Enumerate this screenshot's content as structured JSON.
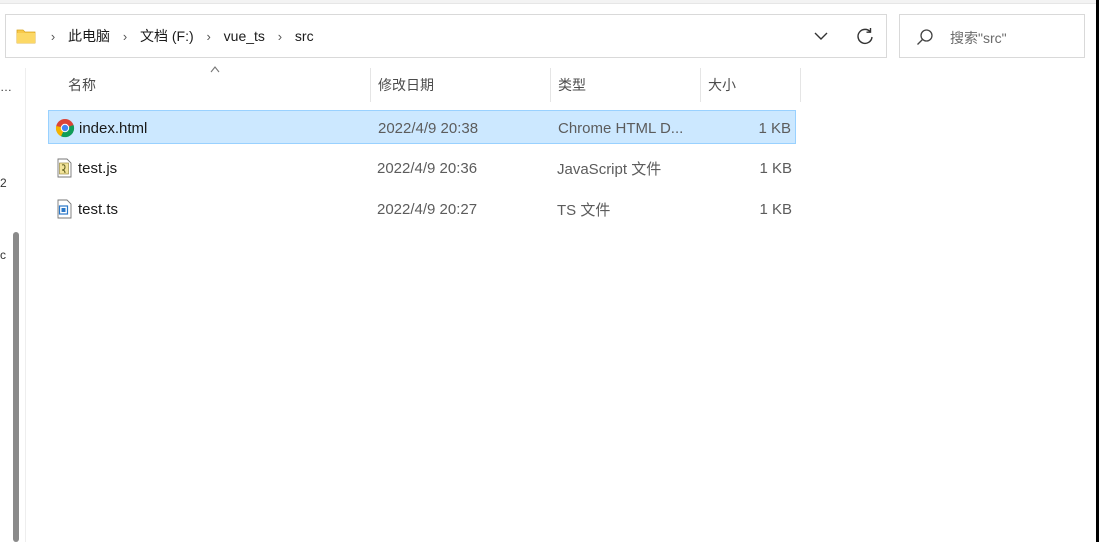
{
  "address_bar": {
    "crumbs": [
      "此电脑",
      "文档 (F:)",
      "vue_ts",
      "src"
    ],
    "folder_icon": "folder-icon",
    "dropdown_icon": "chevron-down-icon",
    "refresh_icon": "refresh-icon"
  },
  "search": {
    "placeholder": "搜索\"src\"",
    "icon": "search-icon"
  },
  "left_pane": {
    "fragments": [
      "…",
      "2",
      "c"
    ]
  },
  "columns": {
    "name": "名称",
    "date": "修改日期",
    "type": "类型",
    "size": "大小",
    "sort_icon": "sort-up-icon"
  },
  "files": [
    {
      "name": "index.html",
      "date": "2022/4/9 20:38",
      "type": "Chrome HTML D...",
      "size": "1 KB",
      "icon": "chrome-html-icon",
      "selected": true
    },
    {
      "name": "test.js",
      "date": "2022/4/9 20:36",
      "type": "JavaScript 文件",
      "size": "1 KB",
      "icon": "javascript-file-icon",
      "selected": false
    },
    {
      "name": "test.ts",
      "date": "2022/4/9 20:27",
      "type": "TS 文件",
      "size": "1 KB",
      "icon": "ts-file-icon",
      "selected": false
    }
  ],
  "colors": {
    "selection_bg": "#cce8ff",
    "selection_border": "#99d1ff",
    "folder_yellow": "#f8c94a"
  }
}
